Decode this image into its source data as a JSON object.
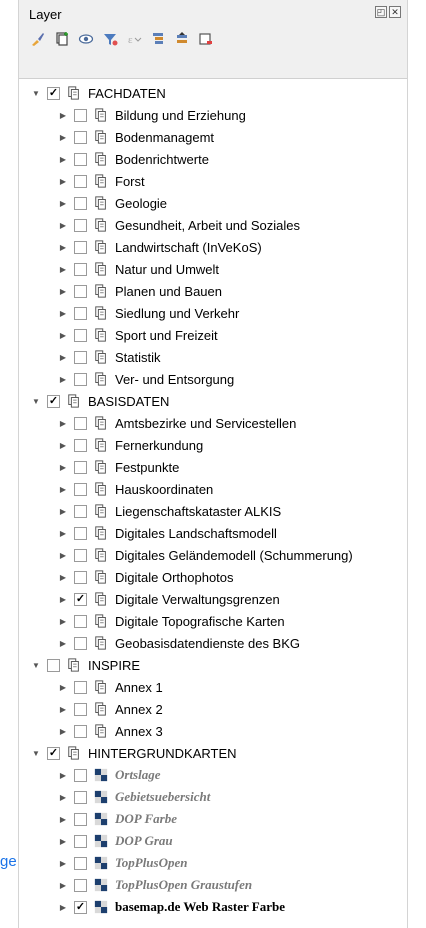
{
  "panel": {
    "title": "Layer",
    "float_btn": "◰",
    "close_btn": "✕"
  },
  "left_edge_text": "ge",
  "toolbar": [
    {
      "name": "style-brush-icon"
    },
    {
      "name": "add-group-icon"
    },
    {
      "name": "visibility-eye-icon"
    },
    {
      "name": "filter-legend-icon"
    },
    {
      "name": "filter-expression-icon"
    },
    {
      "name": "expand-all-icon"
    },
    {
      "name": "collapse-all-icon"
    },
    {
      "name": "remove-layer-icon"
    }
  ],
  "tree": [
    {
      "label": "FACHDATEN",
      "depth": 0,
      "checked": true,
      "expanded": true,
      "icon": "group"
    },
    {
      "label": "Bildung und Erziehung",
      "depth": 1,
      "checked": false,
      "icon": "group"
    },
    {
      "label": "Bodenmanagemt",
      "depth": 1,
      "checked": false,
      "icon": "group"
    },
    {
      "label": "Bodenrichtwerte",
      "depth": 1,
      "checked": false,
      "icon": "group"
    },
    {
      "label": "Forst",
      "depth": 1,
      "checked": false,
      "icon": "group"
    },
    {
      "label": "Geologie",
      "depth": 1,
      "checked": false,
      "icon": "group"
    },
    {
      "label": "Gesundheit, Arbeit und Soziales",
      "depth": 1,
      "checked": false,
      "icon": "group"
    },
    {
      "label": "Landwirtschaft (InVeKoS)",
      "depth": 1,
      "checked": false,
      "icon": "group"
    },
    {
      "label": "Natur und Umwelt",
      "depth": 1,
      "checked": false,
      "icon": "group"
    },
    {
      "label": "Planen und Bauen",
      "depth": 1,
      "checked": false,
      "icon": "group"
    },
    {
      "label": "Siedlung und Verkehr",
      "depth": 1,
      "checked": false,
      "icon": "group"
    },
    {
      "label": "Sport und Freizeit",
      "depth": 1,
      "checked": false,
      "icon": "group"
    },
    {
      "label": "Statistik",
      "depth": 1,
      "checked": false,
      "icon": "group"
    },
    {
      "label": "Ver- und Entsorgung",
      "depth": 1,
      "checked": false,
      "icon": "group"
    },
    {
      "label": "BASISDATEN",
      "depth": 0,
      "checked": true,
      "expanded": true,
      "icon": "group"
    },
    {
      "label": "Amtsbezirke und Servicestellen",
      "depth": 1,
      "checked": false,
      "icon": "group"
    },
    {
      "label": "Fernerkundung",
      "depth": 1,
      "checked": false,
      "icon": "group"
    },
    {
      "label": "Festpunkte",
      "depth": 1,
      "checked": false,
      "icon": "group"
    },
    {
      "label": "Hauskoordinaten",
      "depth": 1,
      "checked": false,
      "icon": "group"
    },
    {
      "label": "Liegenschaftskataster ALKIS",
      "depth": 1,
      "checked": false,
      "icon": "group"
    },
    {
      "label": "Digitales Landschaftsmodell",
      "depth": 1,
      "checked": false,
      "icon": "group"
    },
    {
      "label": "Digitales Geländemodell (Schummerung)",
      "depth": 1,
      "checked": false,
      "icon": "group"
    },
    {
      "label": "Digitale Orthophotos",
      "depth": 1,
      "checked": false,
      "icon": "group"
    },
    {
      "label": "Digitale Verwaltungsgrenzen",
      "depth": 1,
      "checked": true,
      "icon": "group"
    },
    {
      "label": "Digitale Topografische Karten",
      "depth": 1,
      "checked": false,
      "icon": "group"
    },
    {
      "label": "Geobasisdatendienste des BKG",
      "depth": 1,
      "checked": false,
      "icon": "group"
    },
    {
      "label": "INSPIRE",
      "depth": 0,
      "checked": false,
      "expanded": true,
      "icon": "group"
    },
    {
      "label": "Annex 1",
      "depth": 1,
      "checked": false,
      "icon": "group"
    },
    {
      "label": "Annex 2",
      "depth": 1,
      "checked": false,
      "icon": "group"
    },
    {
      "label": "Annex 3",
      "depth": 1,
      "checked": false,
      "icon": "group"
    },
    {
      "label": "HINTERGRUNDKARTEN",
      "depth": 0,
      "checked": true,
      "expanded": true,
      "icon": "group"
    },
    {
      "label": "Ortslage",
      "depth": 1,
      "checked": false,
      "icon": "raster",
      "style": "italic"
    },
    {
      "label": "Gebietsuebersicht",
      "depth": 1,
      "checked": false,
      "icon": "raster",
      "style": "italic"
    },
    {
      "label": "DOP Farbe",
      "depth": 1,
      "checked": false,
      "icon": "raster",
      "style": "italic"
    },
    {
      "label": "DOP Grau",
      "depth": 1,
      "checked": false,
      "icon": "raster",
      "style": "italic"
    },
    {
      "label": "TopPlusOpen",
      "depth": 1,
      "checked": false,
      "icon": "raster",
      "style": "italic"
    },
    {
      "label": "TopPlusOpen Graustufen",
      "depth": 1,
      "checked": false,
      "icon": "raster",
      "style": "italic"
    },
    {
      "label": "basemap.de Web Raster Farbe",
      "depth": 1,
      "checked": true,
      "icon": "raster",
      "style": "bold"
    }
  ]
}
